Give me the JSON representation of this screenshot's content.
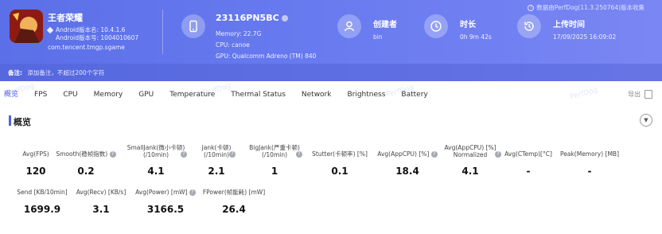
{
  "header": {
    "collector_text": "数据由PerfDog(11.3.250764)版本收集",
    "app": {
      "name": "王者荣耀",
      "android_version_name": "Android版本名: 10.4.1.6",
      "android_version_code": "Android版本号: 1004010607",
      "package": "com.tencent.tmgp.sgame"
    },
    "device": {
      "name": "23116PN5BC",
      "memory": "Memory: 22.7G",
      "cpu": "CPU: canoe",
      "gpu": "GPU: Qualcomm Adreno (TM) 840"
    },
    "creator": {
      "title": "创建者",
      "value": "bin"
    },
    "duration": {
      "title": "时长",
      "value": "0h 9m 42s"
    },
    "upload": {
      "title": "上传时间",
      "value": "17/09/2025 16:09:02"
    },
    "note": {
      "label": "备注:",
      "placeholder": "添加备注，不超过200个字符"
    }
  },
  "tabs": [
    "概览",
    "FPS",
    "CPU",
    "Memory",
    "GPU",
    "Temperature",
    "Thermal Status",
    "Network",
    "Brightness",
    "Battery"
  ],
  "export_label": "导出",
  "section_title": "概览",
  "metrics_row1": [
    {
      "label": "Avg(FPS)",
      "value": "120"
    },
    {
      "label": "Smooth(稳帧指数)",
      "value": "0.2"
    },
    {
      "label": "SmallJank(微小卡顿)\n(/10min)",
      "value": "4.1"
    },
    {
      "label": "Jank(卡顿)\n(/10min)",
      "value": "2.1"
    },
    {
      "label": "BigJank(严重卡顿)\n(/10min)",
      "value": "1"
    },
    {
      "label": "Stutter(卡顿率) [%]",
      "value": "0.1"
    },
    {
      "label": "Avg(AppCPU) [%]",
      "value": "18.4"
    },
    {
      "label": "Avg(AppCPU) [%]\nNormalized",
      "value": "4.1"
    },
    {
      "label": "Avg(CTemp)[°C]",
      "value": "-"
    },
    {
      "label": "Peak(Memory) [MB]",
      "value": "-"
    }
  ],
  "metrics_row2": [
    {
      "label": "Send [KB/10min]",
      "value": "1699.9"
    },
    {
      "label": "Avg(Recv) [KB/s]",
      "value": "3.1"
    },
    {
      "label": "Avg(Power) [mW]",
      "value": "3166.5"
    },
    {
      "label": "FPower(帧能耗) [mW]",
      "value": "26.4"
    }
  ],
  "watermark": "PerfDog",
  "colors": {
    "accent": "#4e63e6",
    "header_start": "#5b6fe8",
    "header_end": "#7a86f3"
  }
}
